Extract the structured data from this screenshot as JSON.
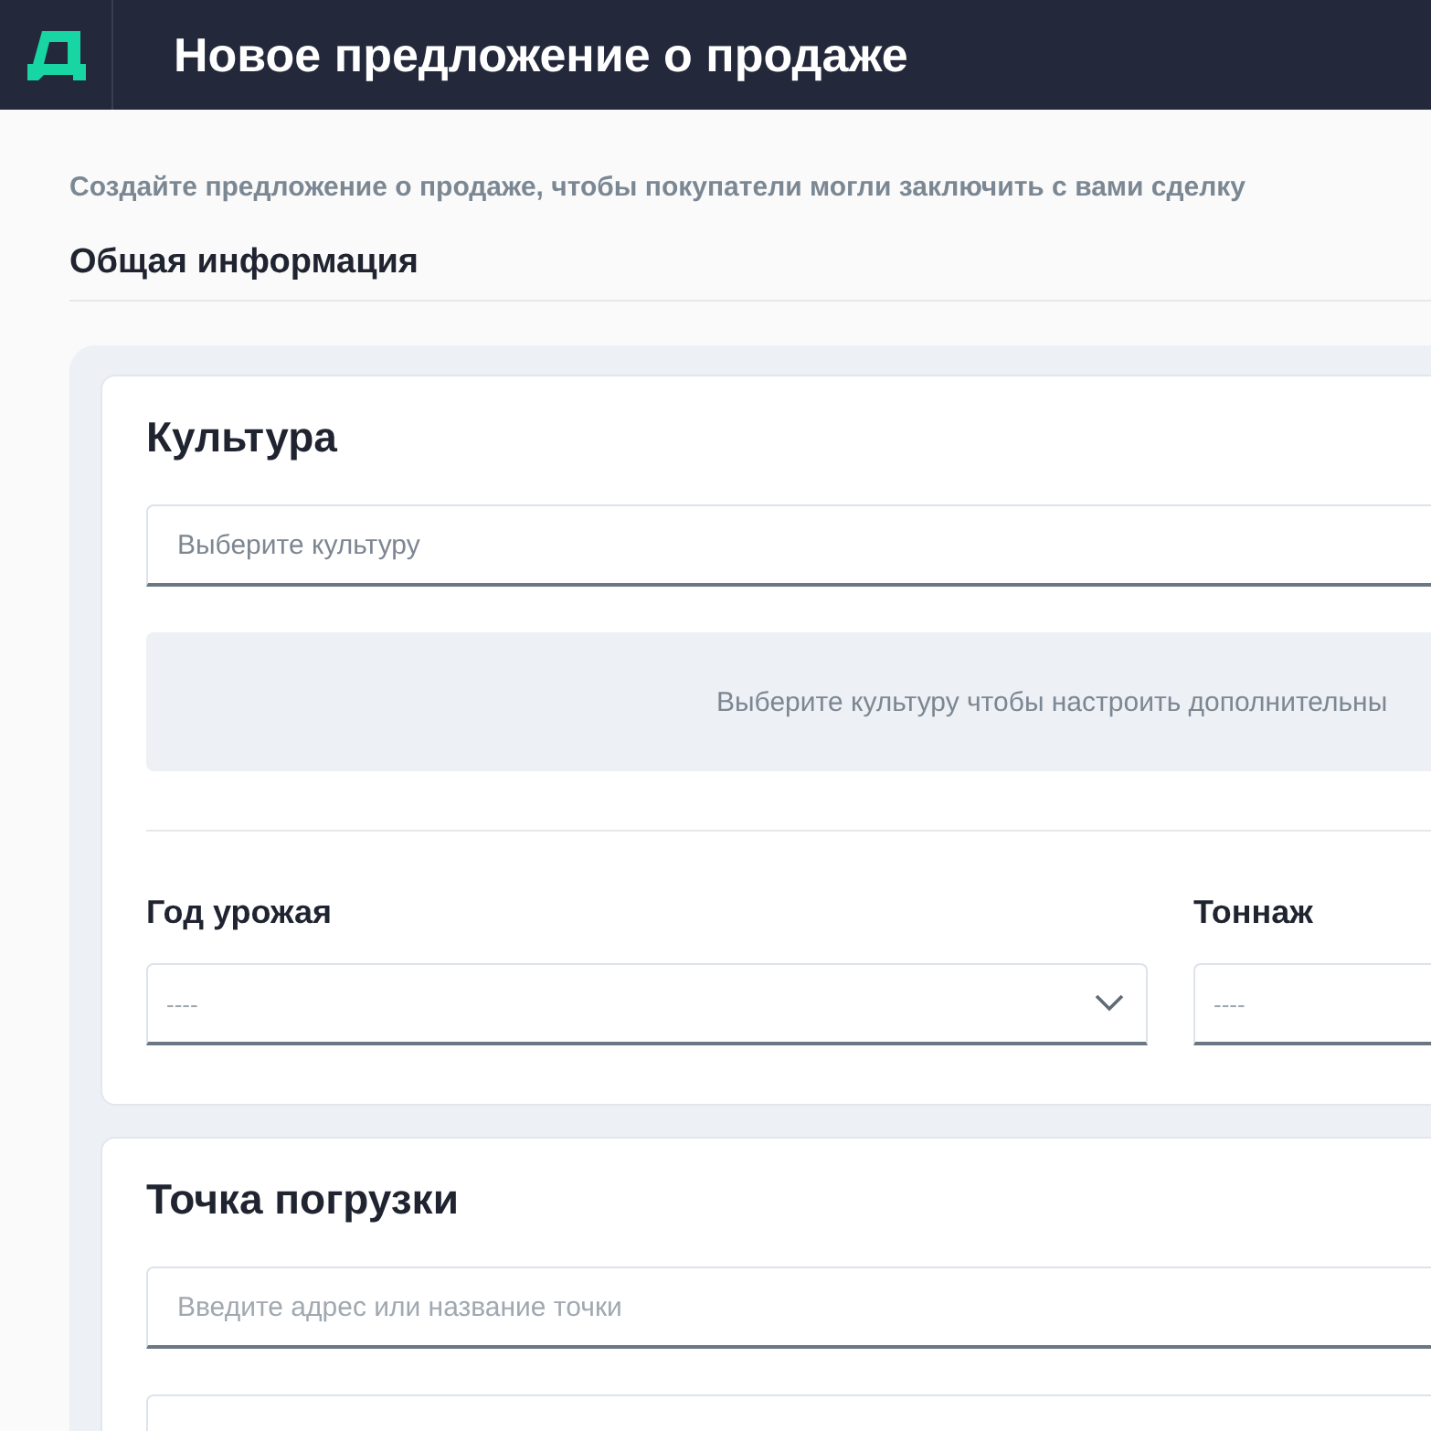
{
  "header": {
    "title": "Новое предложение о продаже"
  },
  "subtitle": "Создайте предложение о продаже, чтобы покупатели могли заключить с вами сделку",
  "section_title": "Общая информация",
  "culture_card": {
    "title": "Культура",
    "field": {
      "placeholder": "Выберите культуру"
    },
    "notice": "Выберите культуру чтобы настроить дополнительны",
    "fields": [
      {
        "label": "Год урожая",
        "kind": "select",
        "placeholder": "----"
      },
      {
        "label": "Тоннаж",
        "kind": "input",
        "placeholder": "----"
      }
    ]
  },
  "loading_card": {
    "title": "Точка погрузки",
    "field": {
      "placeholder": "Введите адрес или название точки"
    }
  }
}
